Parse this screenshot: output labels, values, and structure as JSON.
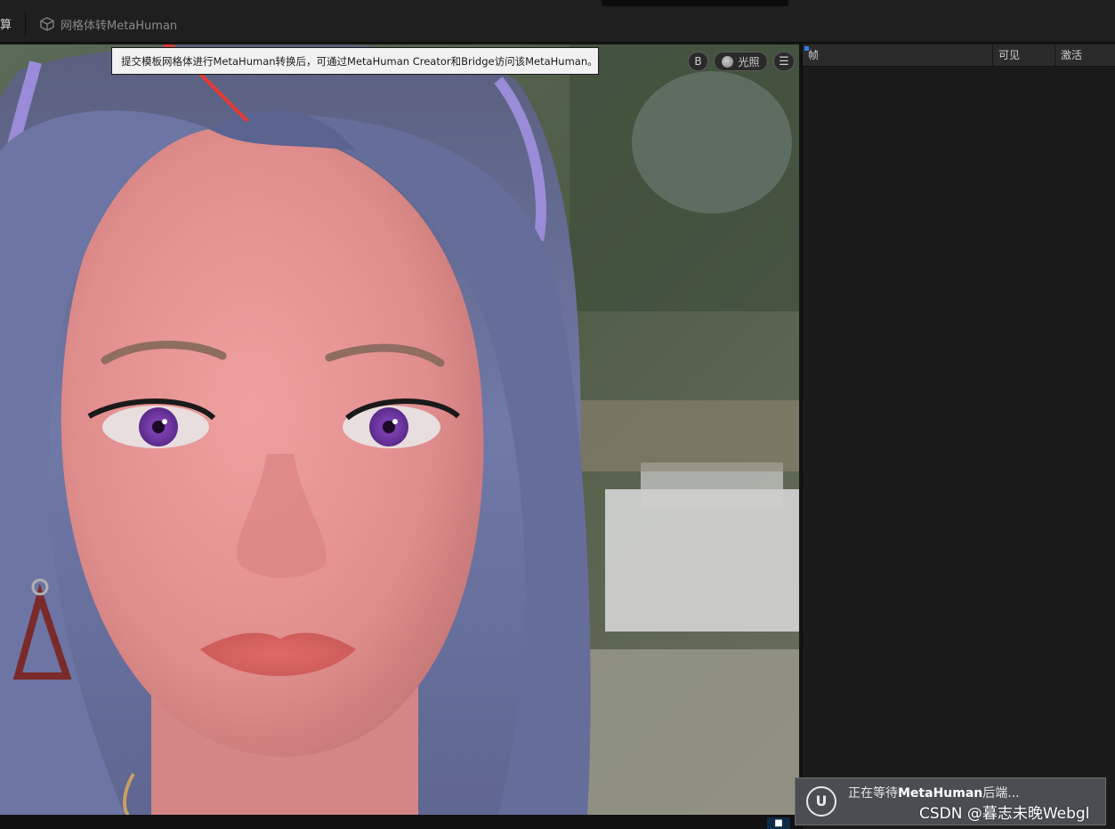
{
  "toolbar": {
    "first_label": "算",
    "tab_label": "网格体转MetaHuman",
    "tab_icon": "cube-icon"
  },
  "tooltip": {
    "text": "提交模板网格体进行MetaHuman转换后，可通过MetaHuman Creator和Bridge访问该MetaHuman。"
  },
  "viewport": {
    "buttons": {
      "b_label": "B",
      "lighting_label": "光照",
      "menu_icon": "hamburger-icon"
    }
  },
  "panel": {
    "columns": [
      "帧",
      "可见",
      "激活"
    ]
  },
  "toast": {
    "prefix": "正在等待",
    "bold": "MetaHuman",
    "suffix": "后端...",
    "icon": "unreal-logo-icon"
  },
  "watermark": "CSDN @暮志未晚Webgl",
  "colors": {
    "hair": "#6e78a8",
    "eyes": "#7b3fb0",
    "arrow": "#e53935"
  }
}
